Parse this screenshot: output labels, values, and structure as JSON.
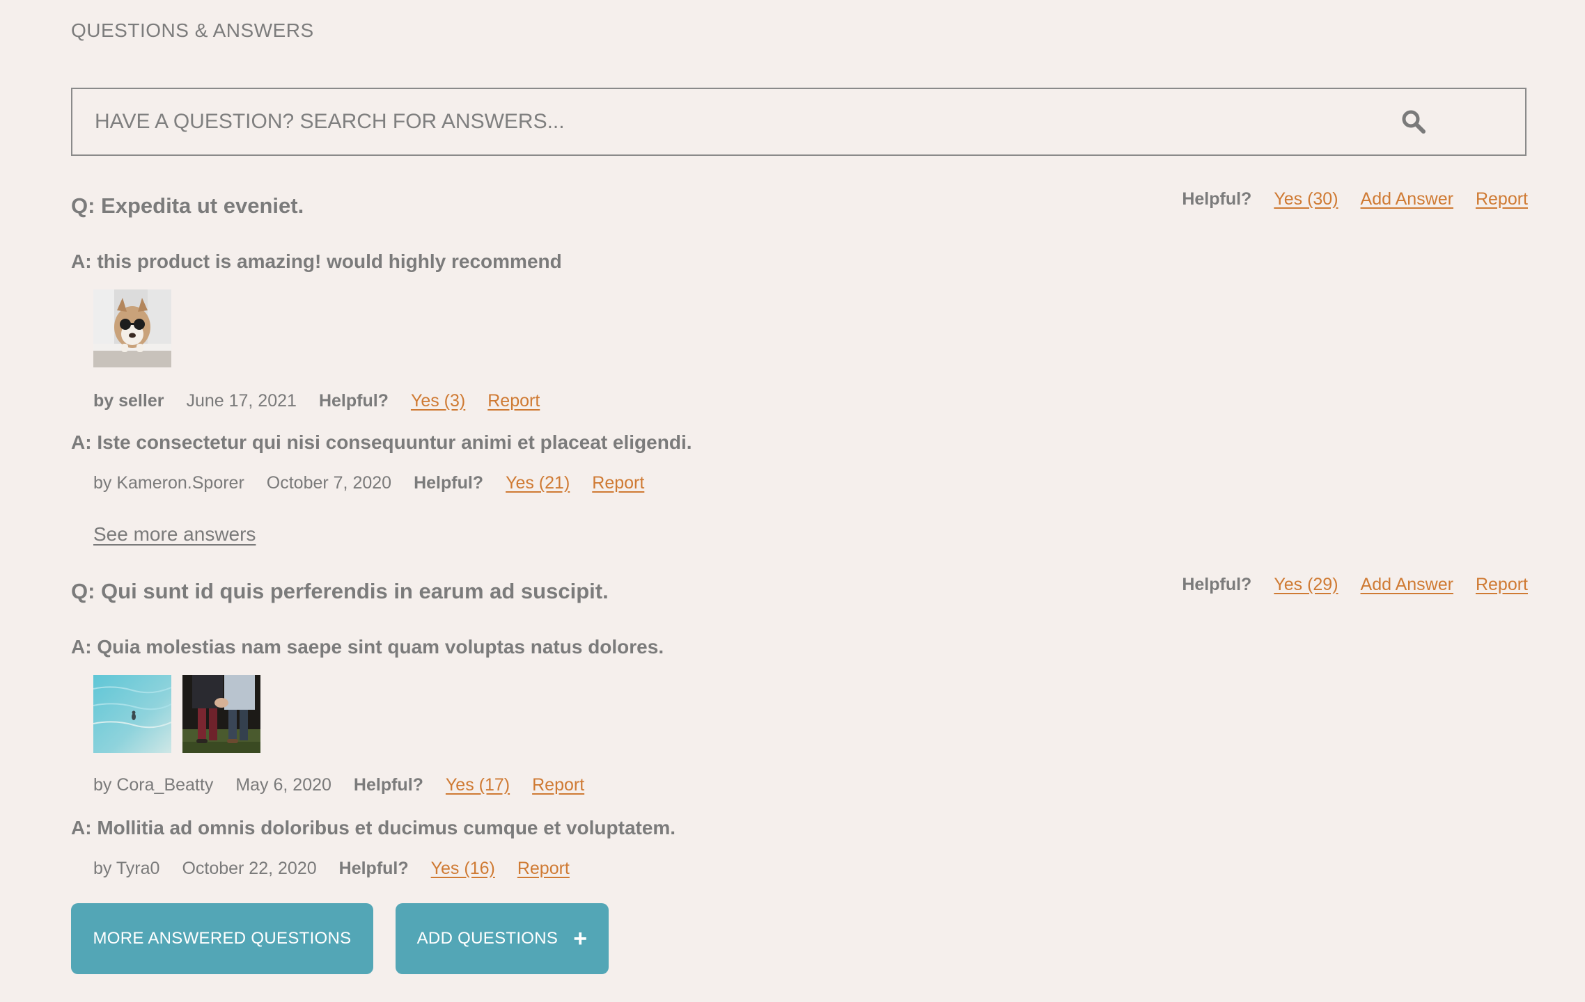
{
  "header": {
    "title": "QUESTIONS & ANSWERS"
  },
  "search": {
    "placeholder": "HAVE A QUESTION? SEARCH FOR ANSWERS...",
    "icon": "search-icon"
  },
  "questions": [
    {
      "text": "Q: Expedita ut eveniet.",
      "helpful_label": "Helpful?",
      "yes_label": "Yes (30)",
      "add_answer_label": "Add Answer",
      "report_label": "Report",
      "answers": [
        {
          "text": "A: this product is amazing! would highly recommend",
          "photos": [
            "dog-with-sunglasses-photo"
          ],
          "author": "by seller",
          "date": "June 17, 2021",
          "helpful_label": "Helpful?",
          "yes_label": "Yes (3)",
          "report_label": "Report"
        },
        {
          "text": "A: Iste consectetur qui nisi consequuntur animi et placeat eligendi.",
          "photos": [],
          "author": "by Kameron.Sporer",
          "date": "October 7, 2020",
          "helpful_label": "Helpful?",
          "yes_label": "Yes (21)",
          "report_label": "Report"
        }
      ],
      "see_more_label": "See more answers"
    },
    {
      "text": "Q: Qui sunt id quis perferendis in earum ad suscipit.",
      "helpful_label": "Helpful?",
      "yes_label": "Yes (29)",
      "add_answer_label": "Add Answer",
      "report_label": "Report",
      "answers": [
        {
          "text": "A: Quia molestias nam saepe sint quam voluptas natus dolores.",
          "photos": [
            "ocean-swimmer-photo",
            "couple-holding-hands-photo"
          ],
          "author": "by Cora_Beatty",
          "date": "May 6, 2020",
          "helpful_label": "Helpful?",
          "yes_label": "Yes (17)",
          "report_label": "Report"
        },
        {
          "text": "A: Mollitia ad omnis doloribus et ducimus cumque et voluptatem.",
          "photos": [],
          "author": "by Tyra0",
          "date": "October 22, 2020",
          "helpful_label": "Helpful?",
          "yes_label": "Yes (16)",
          "report_label": "Report"
        }
      ]
    }
  ],
  "buttons": {
    "more_answered_label": "MORE ANSWERED QUESTIONS",
    "add_questions_label": "ADD QUESTIONS",
    "add_icon": "plus-icon"
  },
  "colors": {
    "background": "#f5efec",
    "text": "#7a7a7a",
    "link": "#cf7a33",
    "button": "#53a6b6"
  }
}
